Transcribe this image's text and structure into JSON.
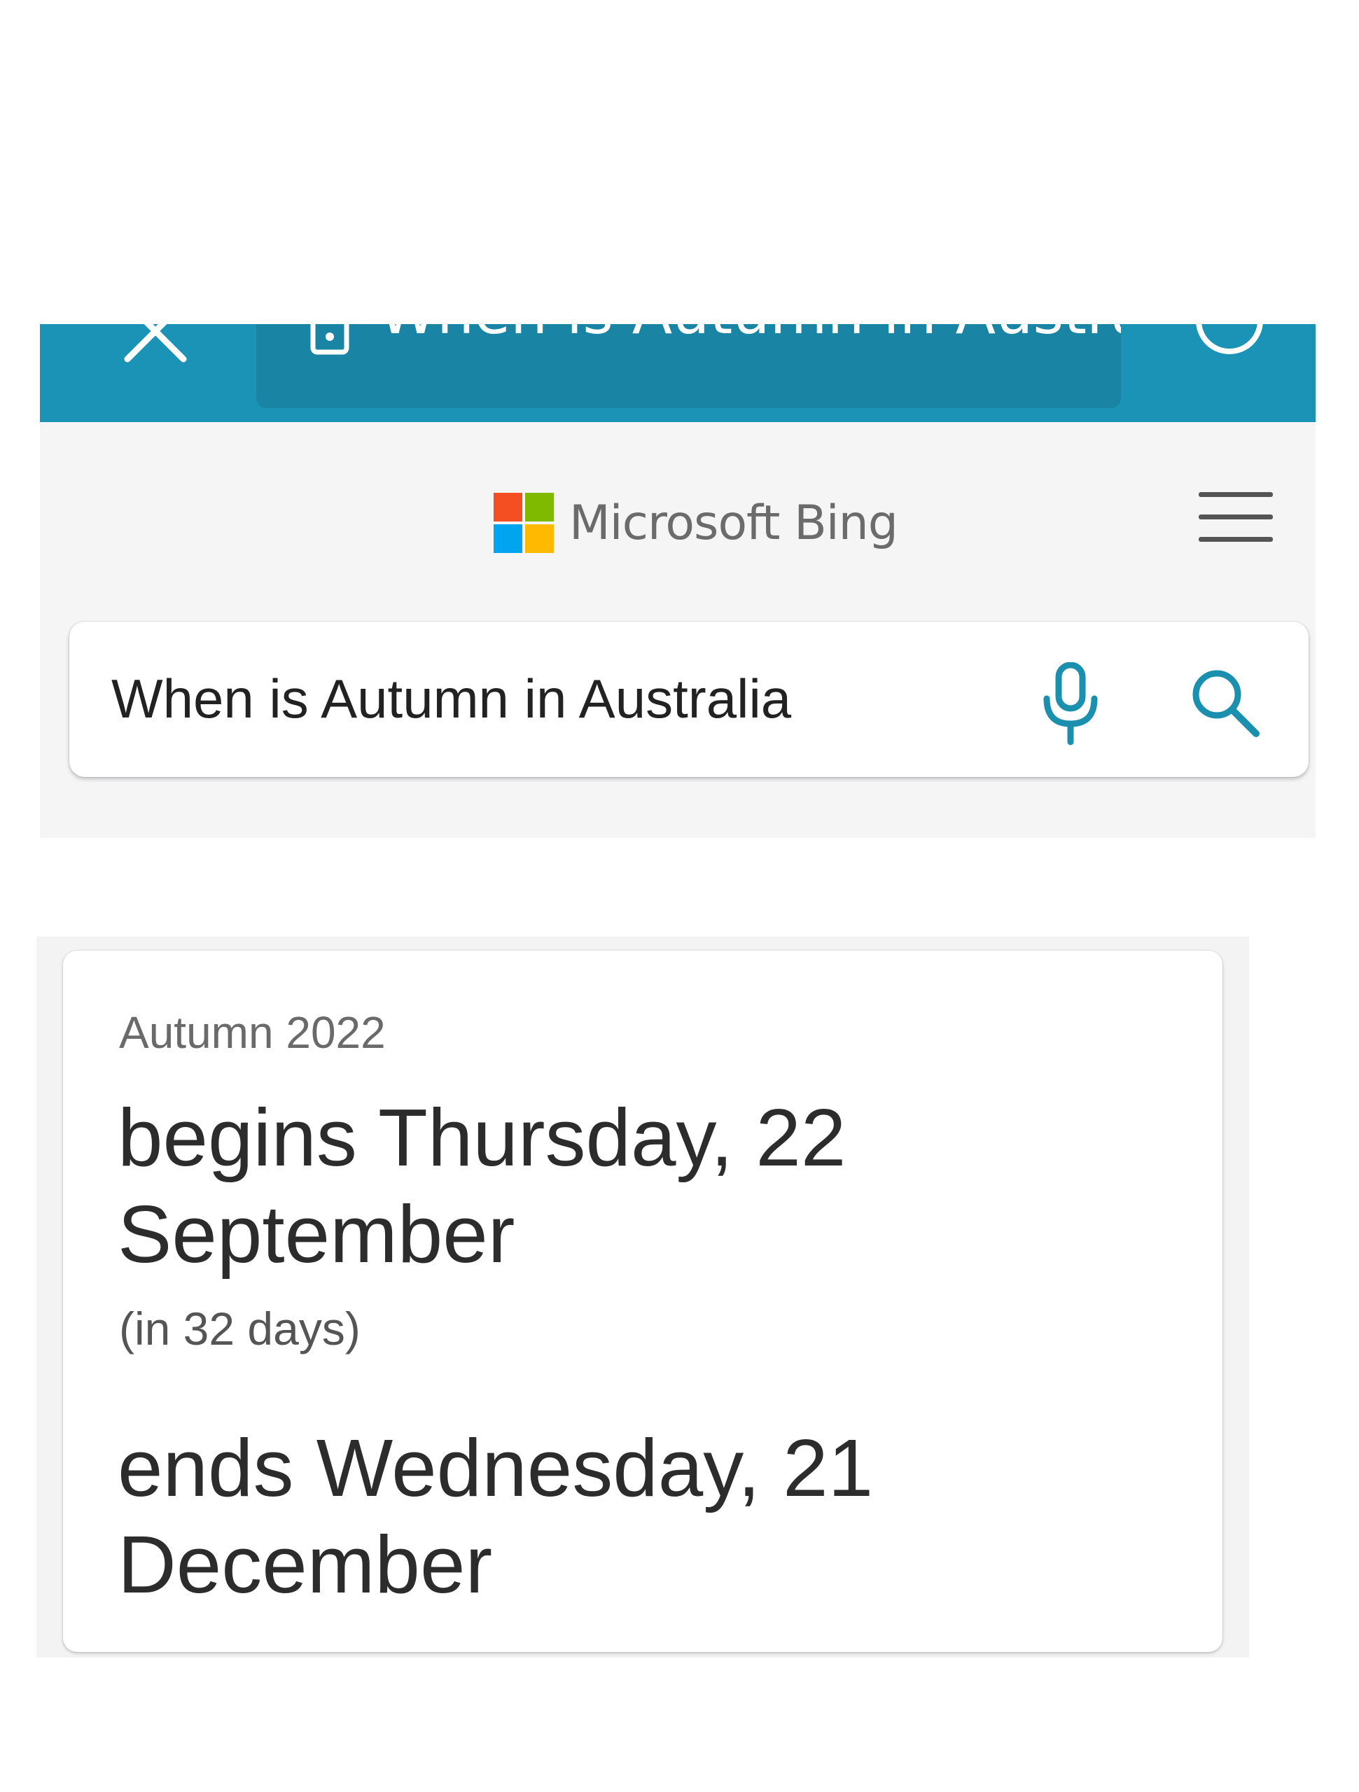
{
  "browser": {
    "url_title": "When is Autumn in Austral...",
    "accent_color": "#1b93b6",
    "icons": [
      "close-icon",
      "lock-icon",
      "tabs-icon"
    ]
  },
  "header": {
    "brand": "Microsoft Bing",
    "logo_colors": [
      "#f25022",
      "#7fba00",
      "#00a4ef",
      "#ffb900"
    ],
    "menu_icon": "hamburger-menu-icon"
  },
  "search": {
    "query": "When is Autumn in Australia",
    "icon_color": "#1b8fae",
    "icons": [
      "microphone-icon",
      "search-icon"
    ]
  },
  "answer": {
    "season": "Autumn 2022",
    "begins_line1": "begins Thursday, 22",
    "begins_line2": "September",
    "countdown": "(in 32 days)",
    "ends_line1": "ends Wednesday, 21",
    "ends_line2": "December"
  }
}
